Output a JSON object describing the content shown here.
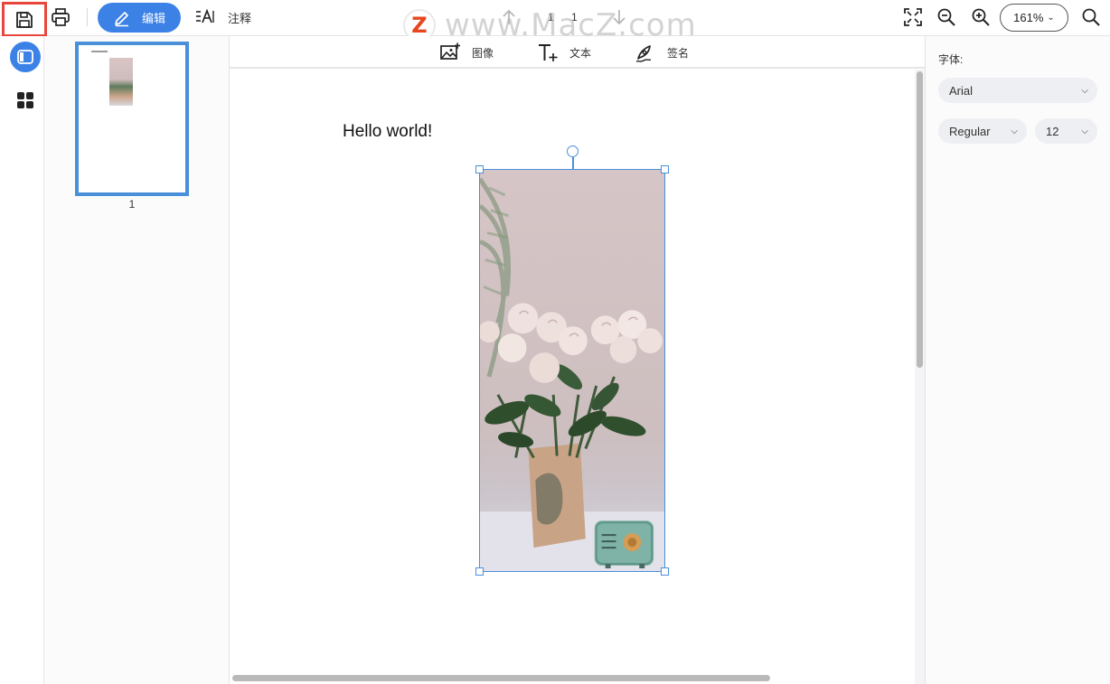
{
  "toolbar": {
    "edit_label": "编辑",
    "annotate_label": "注释",
    "page_current": "1",
    "page_total": "1",
    "zoom_value": "161%"
  },
  "watermark": {
    "logo_letter": "Z",
    "text": "www.MacZ.com"
  },
  "thumbnails": {
    "pages": [
      {
        "number": "1"
      }
    ]
  },
  "insert_toolbar": {
    "image_label": "图像",
    "text_label": "文本",
    "signature_label": "签名"
  },
  "document": {
    "text_content": "Hello world!"
  },
  "properties": {
    "font_label": "字体:",
    "font_family": "Arial",
    "font_weight": "Regular",
    "font_size": "12"
  },
  "colors": {
    "accent": "#3c82e6",
    "selection": "#4a8fda",
    "highlight_box": "#e8463c"
  }
}
